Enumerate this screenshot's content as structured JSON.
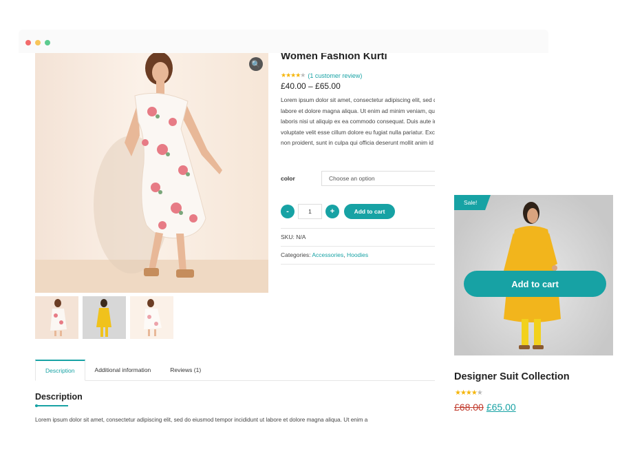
{
  "window": {
    "dots": [
      "#f26b6b",
      "#f7c55a",
      "#5ccb8f"
    ]
  },
  "product": {
    "title": "Women Fashion Kurti",
    "rating_stars": "★★★★",
    "rating_star_empty": "★",
    "review_link": "(1 customer review)",
    "price": "£40.00 – £65.00",
    "description": "Lorem ipsum dolor sit amet, consectetur adipiscing elit, sed do eiusmod tempor incididunt ut labore et dolore magna aliqua. Ut enim ad minim veniam, quis nostrud exercitation ullamco laboris nisi ut aliquip ex ea commodo consequat. Duis aute irure dolor in reprehenderit in voluptate velit esse cillum dolore eu fugiat nulla pariatur. Excepteur sint occaecat cupidatat non proident, sunt in culpa qui officia deserunt mollit anim id est laborum.",
    "color_label": "color",
    "color_select": "Choose an option",
    "qty_minus": "-",
    "qty_value": "1",
    "qty_plus": "+",
    "add_to_cart": "Add to cart",
    "sku_label": "SKU:",
    "sku_value": "N/A",
    "categories_label": "Categories:",
    "category_1": "Accessories",
    "category_sep": ",",
    "category_2": "Hoodies"
  },
  "tabs": [
    "Description",
    "Additional information",
    "Reviews (1)"
  ],
  "description_section": {
    "heading": "Description",
    "text": "Lorem ipsum dolor sit amet, consectetur adipiscing elit, sed do eiusmod tempor incididunt ut labore et dolore magna aliqua. Ut enim a"
  },
  "card": {
    "sale_badge": "Sale!",
    "add_to_cart": "Add to cart",
    "title": "Designer Suit Collection",
    "stars": "★★★★",
    "star_empty": "★",
    "old_price": "£68.00",
    "new_price": "£65.00"
  },
  "colors": {
    "accent": "#17a2a4",
    "star": "#f5b50a",
    "old_price": "#c0392b"
  },
  "icons": {
    "zoom": "magnifier-zoom-icon",
    "select_arrow": "caret-down-icon"
  }
}
